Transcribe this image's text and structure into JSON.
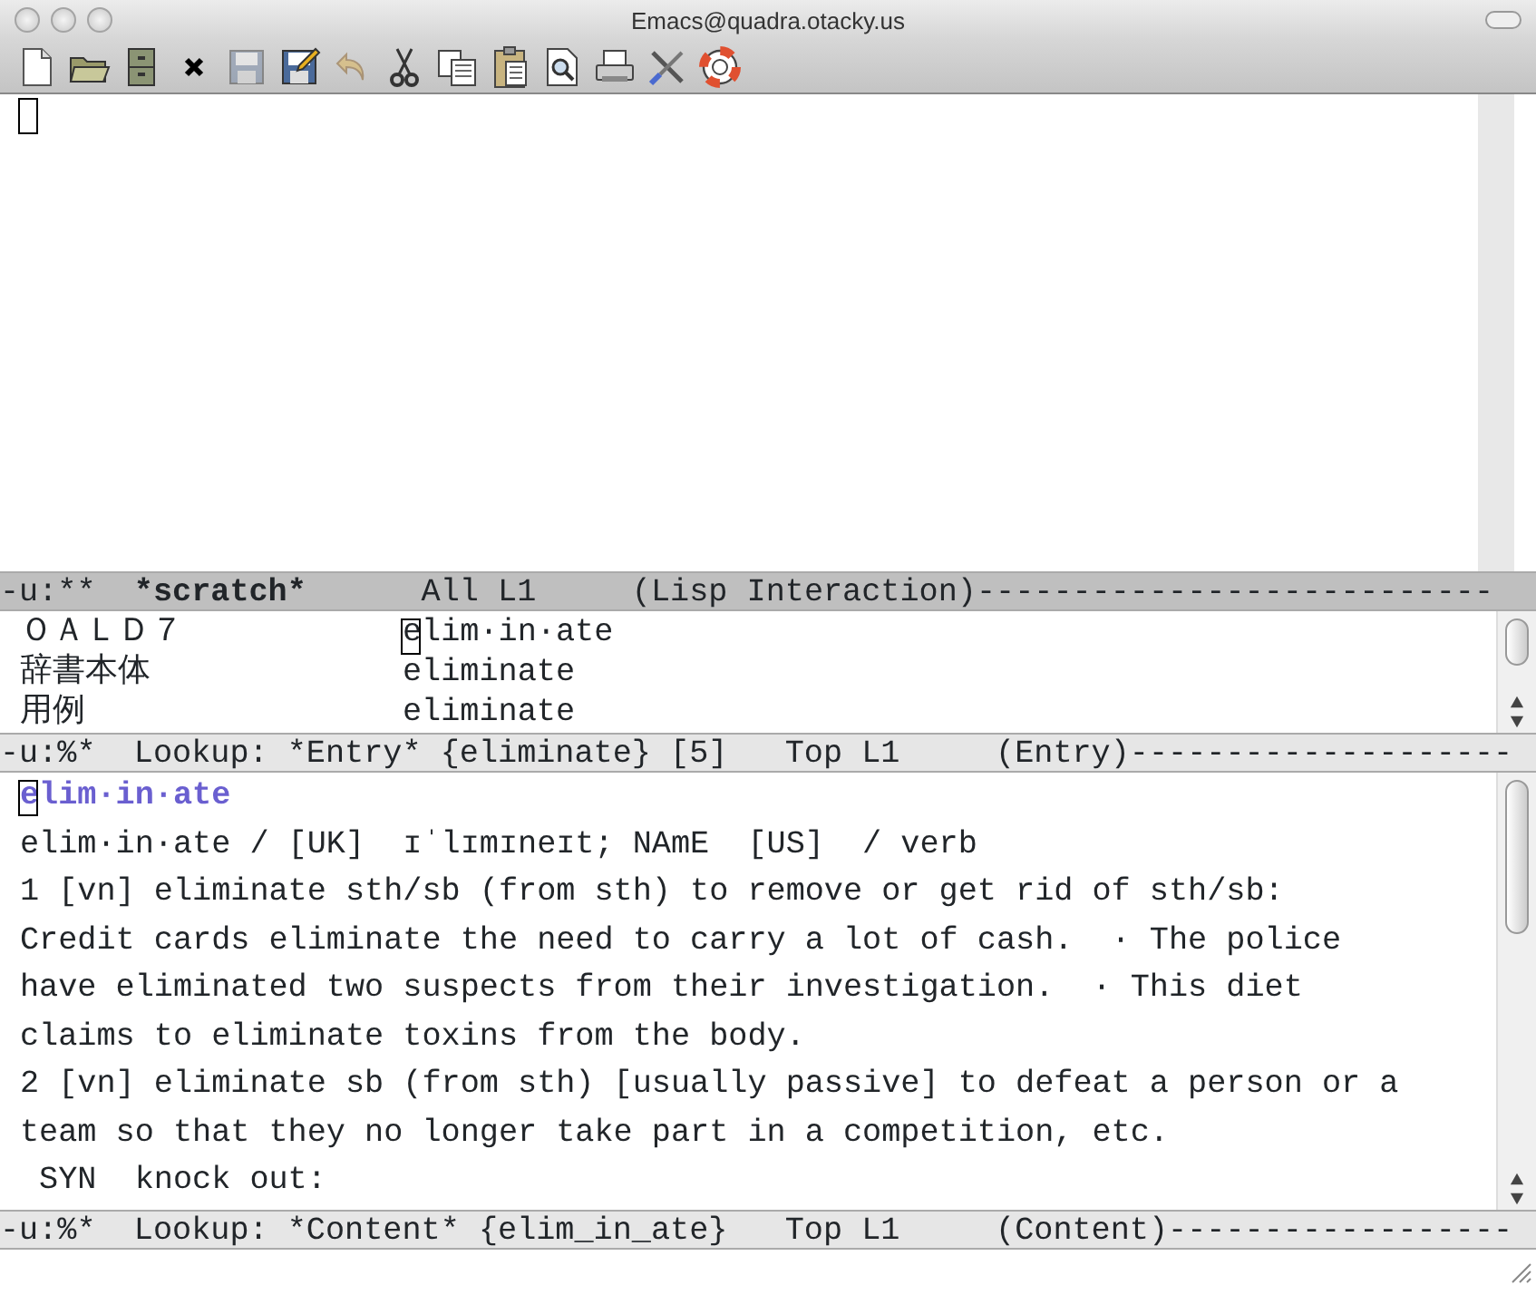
{
  "window": {
    "title": "Emacs@quadra.otacky.us"
  },
  "toolbar": [
    {
      "kind": "new",
      "disabled": false
    },
    {
      "kind": "open",
      "disabled": false
    },
    {
      "kind": "cabinet",
      "disabled": false
    },
    {
      "kind": "close",
      "disabled": false
    },
    {
      "kind": "save",
      "disabled": true
    },
    {
      "kind": "saveas",
      "disabled": false
    },
    {
      "kind": "undo",
      "disabled": true
    },
    {
      "kind": "cut",
      "disabled": false
    },
    {
      "kind": "copy",
      "disabled": false
    },
    {
      "kind": "paste",
      "disabled": false
    },
    {
      "kind": "search",
      "disabled": false
    },
    {
      "kind": "print",
      "disabled": false
    },
    {
      "kind": "tools",
      "disabled": false
    },
    {
      "kind": "help",
      "disabled": false
    }
  ],
  "panes": [
    {
      "kind": "scratch",
      "cursor": true,
      "modeline": {
        "active": true,
        "segments": [
          {
            "text": "-u:**  ",
            "bold": false
          },
          {
            "text": "*scratch*",
            "bold": true
          },
          {
            "text": "      All L1     (Lisp Interaction)---------------------------",
            "bold": false
          }
        ]
      }
    },
    {
      "kind": "entry",
      "cursor": true,
      "lines": [
        {
          "label": "ＯＡＬＤ７",
          "value": "elim·in·ate"
        },
        {
          "label": "辞書本体",
          "value": "eliminate"
        },
        {
          "label": "用例",
          "value": "eliminate"
        }
      ],
      "modeline": {
        "active": false,
        "segments": [
          {
            "text": "-u:%*  Lookup: *Entry* {eliminate} [5]   Top L1     (Entry)--------------------",
            "bold": false
          }
        ]
      }
    },
    {
      "kind": "content",
      "cursor": true,
      "lines": [
        {
          "kind": "headword",
          "text": "elim·in·ate"
        },
        {
          "kind": "text",
          "text": "elim·in·ate / [UK]  ɪˈlɪmɪneɪt; NAmE  [US]  / verb"
        },
        {
          "kind": "text",
          "text": "1 [vn] eliminate sth/sb (from sth) to remove or get rid of sth/sb:"
        },
        {
          "kind": "text",
          "text": "Credit cards eliminate the need to carry a lot of cash.  · The police"
        },
        {
          "kind": "text",
          "text": "have eliminated two suspects from their investigation.  · This diet"
        },
        {
          "kind": "text",
          "text": "claims to eliminate toxins from the body."
        },
        {
          "kind": "text",
          "text": "2 [vn] eliminate sb (from sth) [usually passive] to defeat a person or a"
        },
        {
          "kind": "text",
          "text": "team so that they no longer take part in a competition, etc."
        },
        {
          "kind": "text",
          "text": " SYN  knock out:"
        }
      ],
      "modeline": {
        "active": false,
        "segments": [
          {
            "text": "-u:%*  Lookup: *Content* {elim_in_ate}   Top L1     (Content)------------------",
            "bold": false
          }
        ]
      }
    }
  ]
}
